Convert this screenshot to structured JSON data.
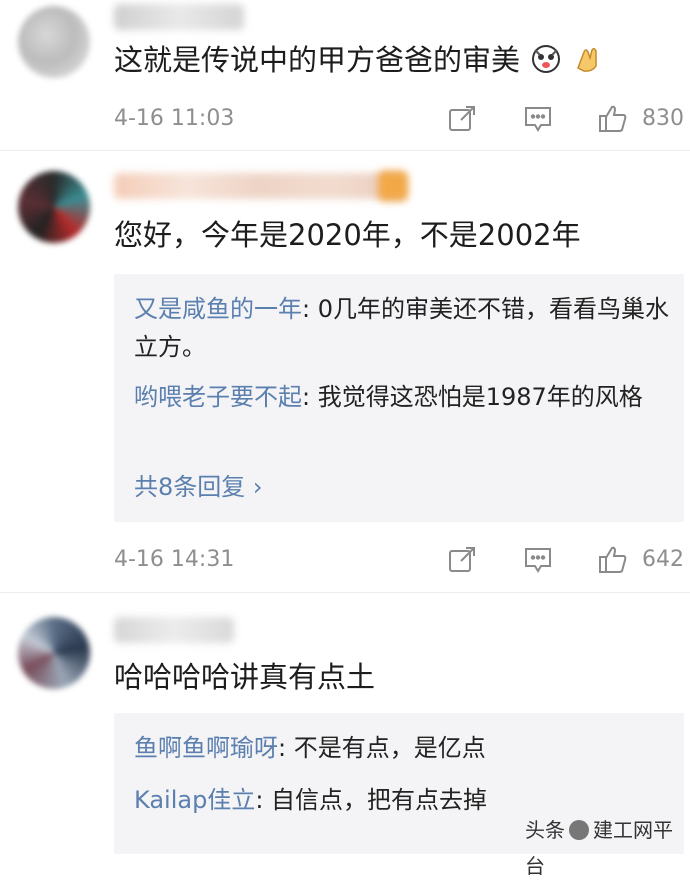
{
  "comments": [
    {
      "text": "这就是传说中的甲方爸爸的审美",
      "time": "4-16 11:03",
      "likes": "830",
      "emojis": [
        "husky-emoji",
        "clapping-hands-emoji"
      ]
    },
    {
      "text": "您好，今年是2020年，不是2002年",
      "time": "4-16 14:31",
      "likes": "642",
      "replies": [
        {
          "name": "又是咸鱼的一年",
          "sep": ": ",
          "text": "0几年的审美还不错，看看鸟巢水立方。"
        },
        {
          "name": "哟喂老子要不起",
          "sep": ": ",
          "text": "我觉得这恐怕是1987年的风格"
        }
      ],
      "more_replies": "共8条回复 ›"
    },
    {
      "text": "哈哈哈哈讲真有点土",
      "replies": [
        {
          "name": "鱼啊鱼啊瑜呀",
          "sep": ": ",
          "text": "不是有点，是亿点"
        },
        {
          "name": "Kailap佳立",
          "sep": ": ",
          "text": "自信点，把有点去掉"
        }
      ]
    }
  ],
  "icons": {
    "share": "share-icon",
    "comment": "comment-icon",
    "like": "thumbs-up-icon"
  },
  "colors": {
    "name_link": "#5b7fae",
    "meta_gray": "#8e8e8e",
    "reply_bg": "#f4f4f6"
  },
  "watermark": {
    "prefix": "头条",
    "name": "建工网平台"
  }
}
